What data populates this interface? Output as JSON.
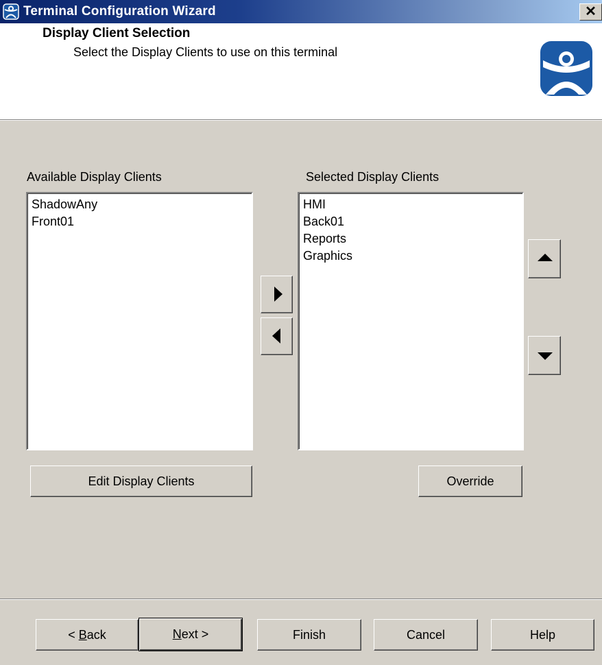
{
  "window": {
    "title": "Terminal Configuration Wizard",
    "close_glyph": "✕"
  },
  "header": {
    "title": "Display Client Selection",
    "subtitle": "Select the Display Clients to use on this terminal"
  },
  "available": {
    "label": "Available Display Clients",
    "items": [
      "ShadowAny",
      "Front01"
    ]
  },
  "selected": {
    "label": "Selected Display Clients",
    "items": [
      "HMI",
      "Back01",
      "Reports",
      "Graphics"
    ]
  },
  "buttons": {
    "edit_display_clients": "Edit Display Clients",
    "override": "Override"
  },
  "footer": {
    "back_prefix": "< ",
    "back_mnemonic": "B",
    "back_rest": "ack",
    "next_mnemonic": "N",
    "next_rest": "ext >",
    "finish": "Finish",
    "cancel": "Cancel",
    "help": "Help"
  },
  "icons": {
    "title_icon": "thinmanager-icon",
    "logo": "thinmanager-logo",
    "add": "arrow-right-icon",
    "remove": "arrow-left-icon",
    "up": "arrow-up-icon",
    "down": "arrow-down-icon"
  },
  "colors": {
    "titlebar_start": "#0a246a",
    "titlebar_end": "#a6caf0",
    "dialog_bg": "#d4d0c8",
    "logo_blue": "#1c5aa6"
  }
}
